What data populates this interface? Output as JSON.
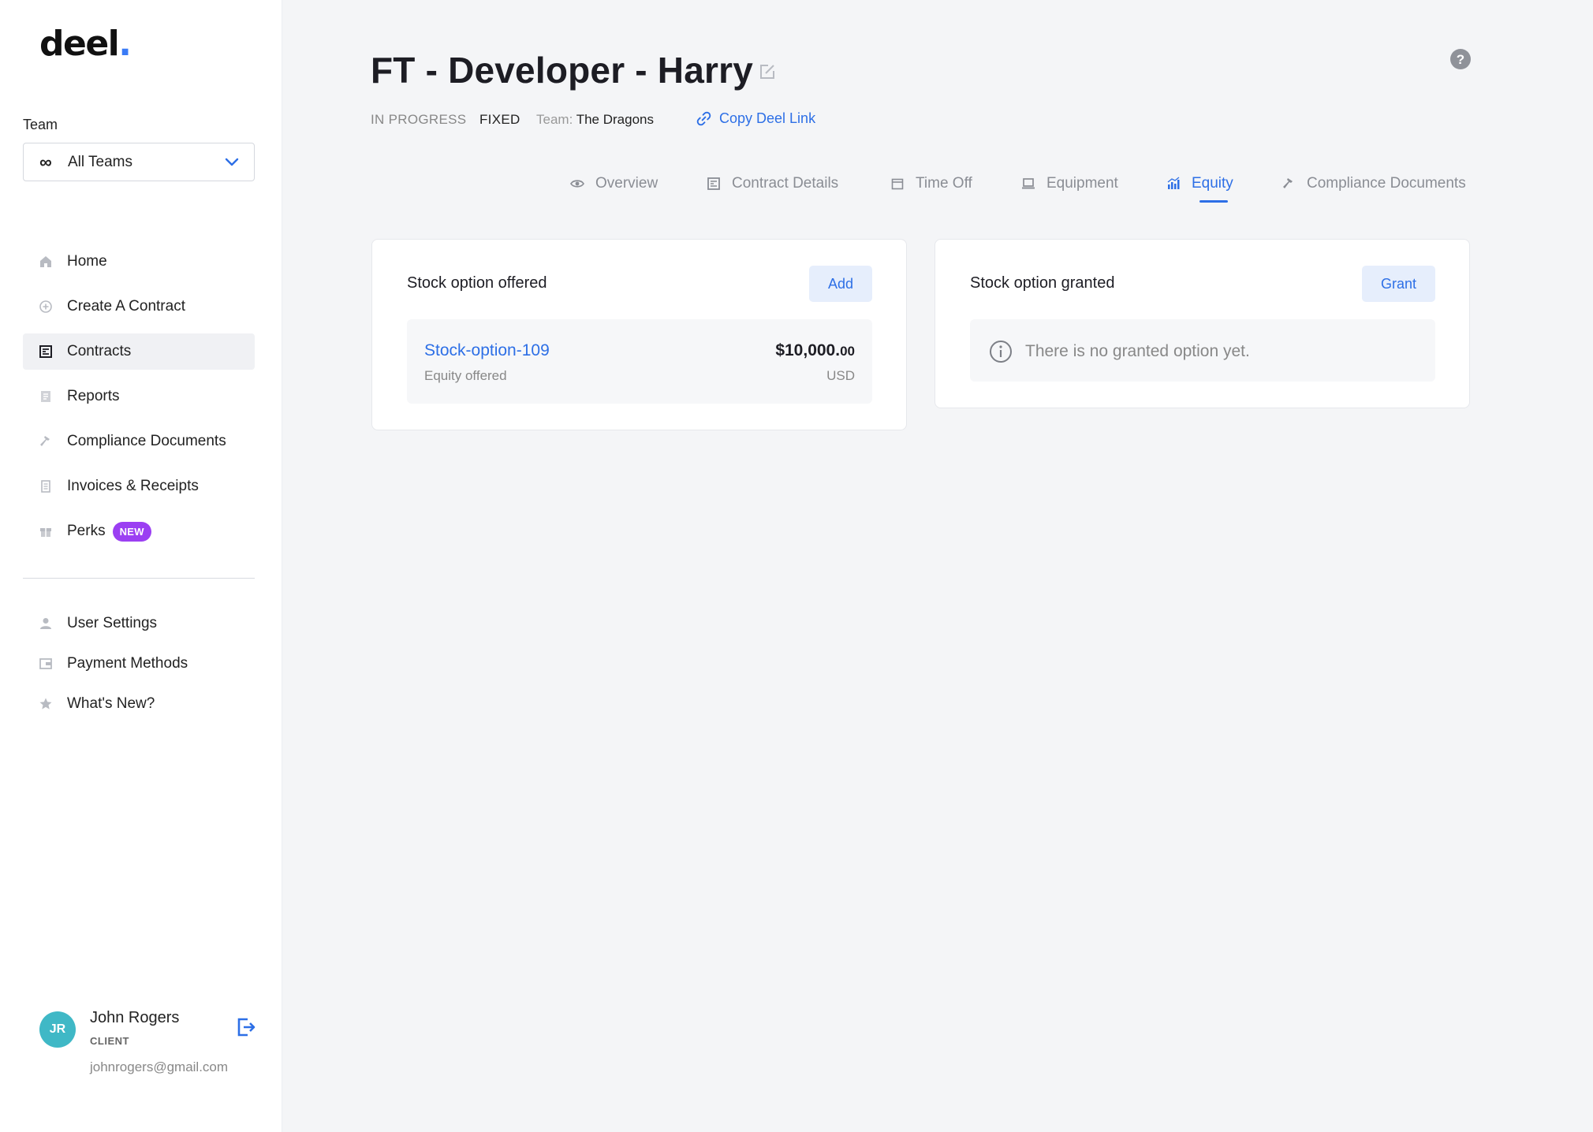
{
  "brand": {
    "name": "deel",
    "dot": "."
  },
  "sidebar": {
    "team_label": "Team",
    "team_select_value": "All Teams",
    "primary_items": [
      {
        "label": "Home",
        "icon": "home-icon"
      },
      {
        "label": "Create A Contract",
        "icon": "plus-circle-icon"
      },
      {
        "label": "Contracts",
        "icon": "contract-icon",
        "active": true
      },
      {
        "label": "Reports",
        "icon": "reports-icon"
      },
      {
        "label": "Compliance Documents",
        "icon": "hammer-icon"
      },
      {
        "label": "Invoices & Receipts",
        "icon": "invoice-icon"
      },
      {
        "label": "Perks",
        "icon": "gift-icon",
        "badge": "NEW"
      }
    ],
    "secondary_items": [
      {
        "label": "User Settings",
        "icon": "user-icon"
      },
      {
        "label": "Payment Methods",
        "icon": "wallet-icon"
      },
      {
        "label": "What's New?",
        "icon": "star-icon"
      }
    ],
    "user": {
      "initials": "JR",
      "name": "John Rogers",
      "role": "CLIENT",
      "email": "johnrogers@gmail.com"
    }
  },
  "header": {
    "title": "FT - Developer - Harry",
    "status": "IN PROGRESS",
    "type": "FIXED",
    "team_label": "Team:",
    "team_value": "The Dragons",
    "copy_link_label": "Copy Deel Link"
  },
  "tabs": [
    {
      "label": "Overview",
      "icon": "eye-icon"
    },
    {
      "label": "Contract Details",
      "icon": "document-icon"
    },
    {
      "label": "Time Off",
      "icon": "calendar-icon"
    },
    {
      "label": "Equipment",
      "icon": "laptop-icon"
    },
    {
      "label": "Equity",
      "icon": "bar-chart-icon",
      "active": true
    },
    {
      "label": "Compliance Documents",
      "icon": "hammer-icon"
    }
  ],
  "offered_card": {
    "title": "Stock option offered",
    "button_label": "Add",
    "option_name": "Stock-option-109",
    "option_sub": "Equity offered",
    "amount_main": "$10,000.",
    "amount_cents": "00",
    "currency": "USD"
  },
  "granted_card": {
    "title": "Stock option granted",
    "button_label": "Grant",
    "empty_message": "There is no granted option yet."
  },
  "colors": {
    "accent": "#2d6fe6",
    "badge": "#9b3ff2",
    "avatar": "#3fb8c6",
    "background": "#f4f5f7"
  }
}
